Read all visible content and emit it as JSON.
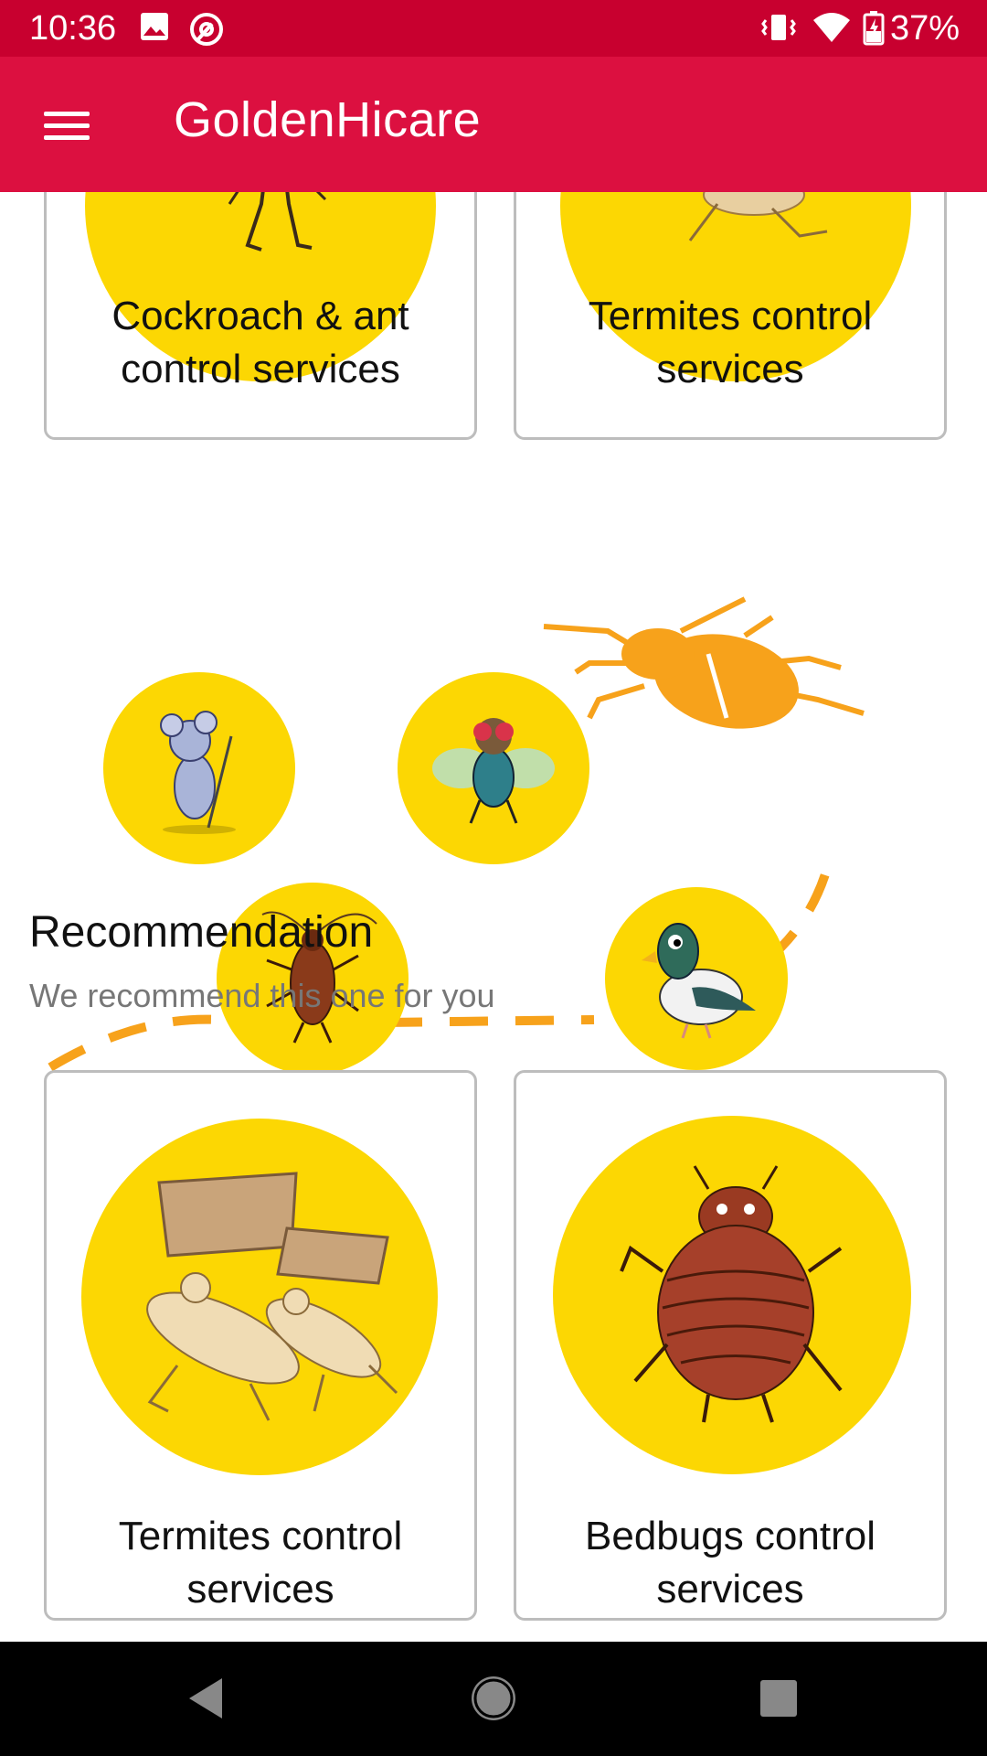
{
  "status_bar": {
    "time": "10:36",
    "battery": "37%",
    "icons": [
      "image-icon",
      "at-sign-icon",
      "vibrate-icon",
      "wifi-icon",
      "battery-charging-icon"
    ]
  },
  "app_bar": {
    "title": "GoldenHicare",
    "menu_icon": "hamburger-menu-icon"
  },
  "top_cards": [
    {
      "label_line1": "Cockroach & ant",
      "label_line2": "control services"
    },
    {
      "label_line1": "Termites control",
      "label_line2": "services"
    }
  ],
  "illustration": {
    "pests": [
      "mouse",
      "fly",
      "cockroach",
      "pigeon",
      "beetle"
    ]
  },
  "recommendation": {
    "title": "Recommendation",
    "subtitle": "We recommend this one for you",
    "cards": [
      {
        "label_line1": "Termites control",
        "label_line2": "services"
      },
      {
        "label_line1": "Bedbugs control",
        "label_line2": "services"
      }
    ]
  },
  "colors": {
    "status_bar": "#c8002f",
    "app_bar": "#dc1040",
    "accent_yellow": "#fcd703",
    "path_orange": "#f7a21b"
  },
  "nav_bar": {
    "icons": [
      "back-icon",
      "home-icon",
      "recents-icon"
    ]
  }
}
